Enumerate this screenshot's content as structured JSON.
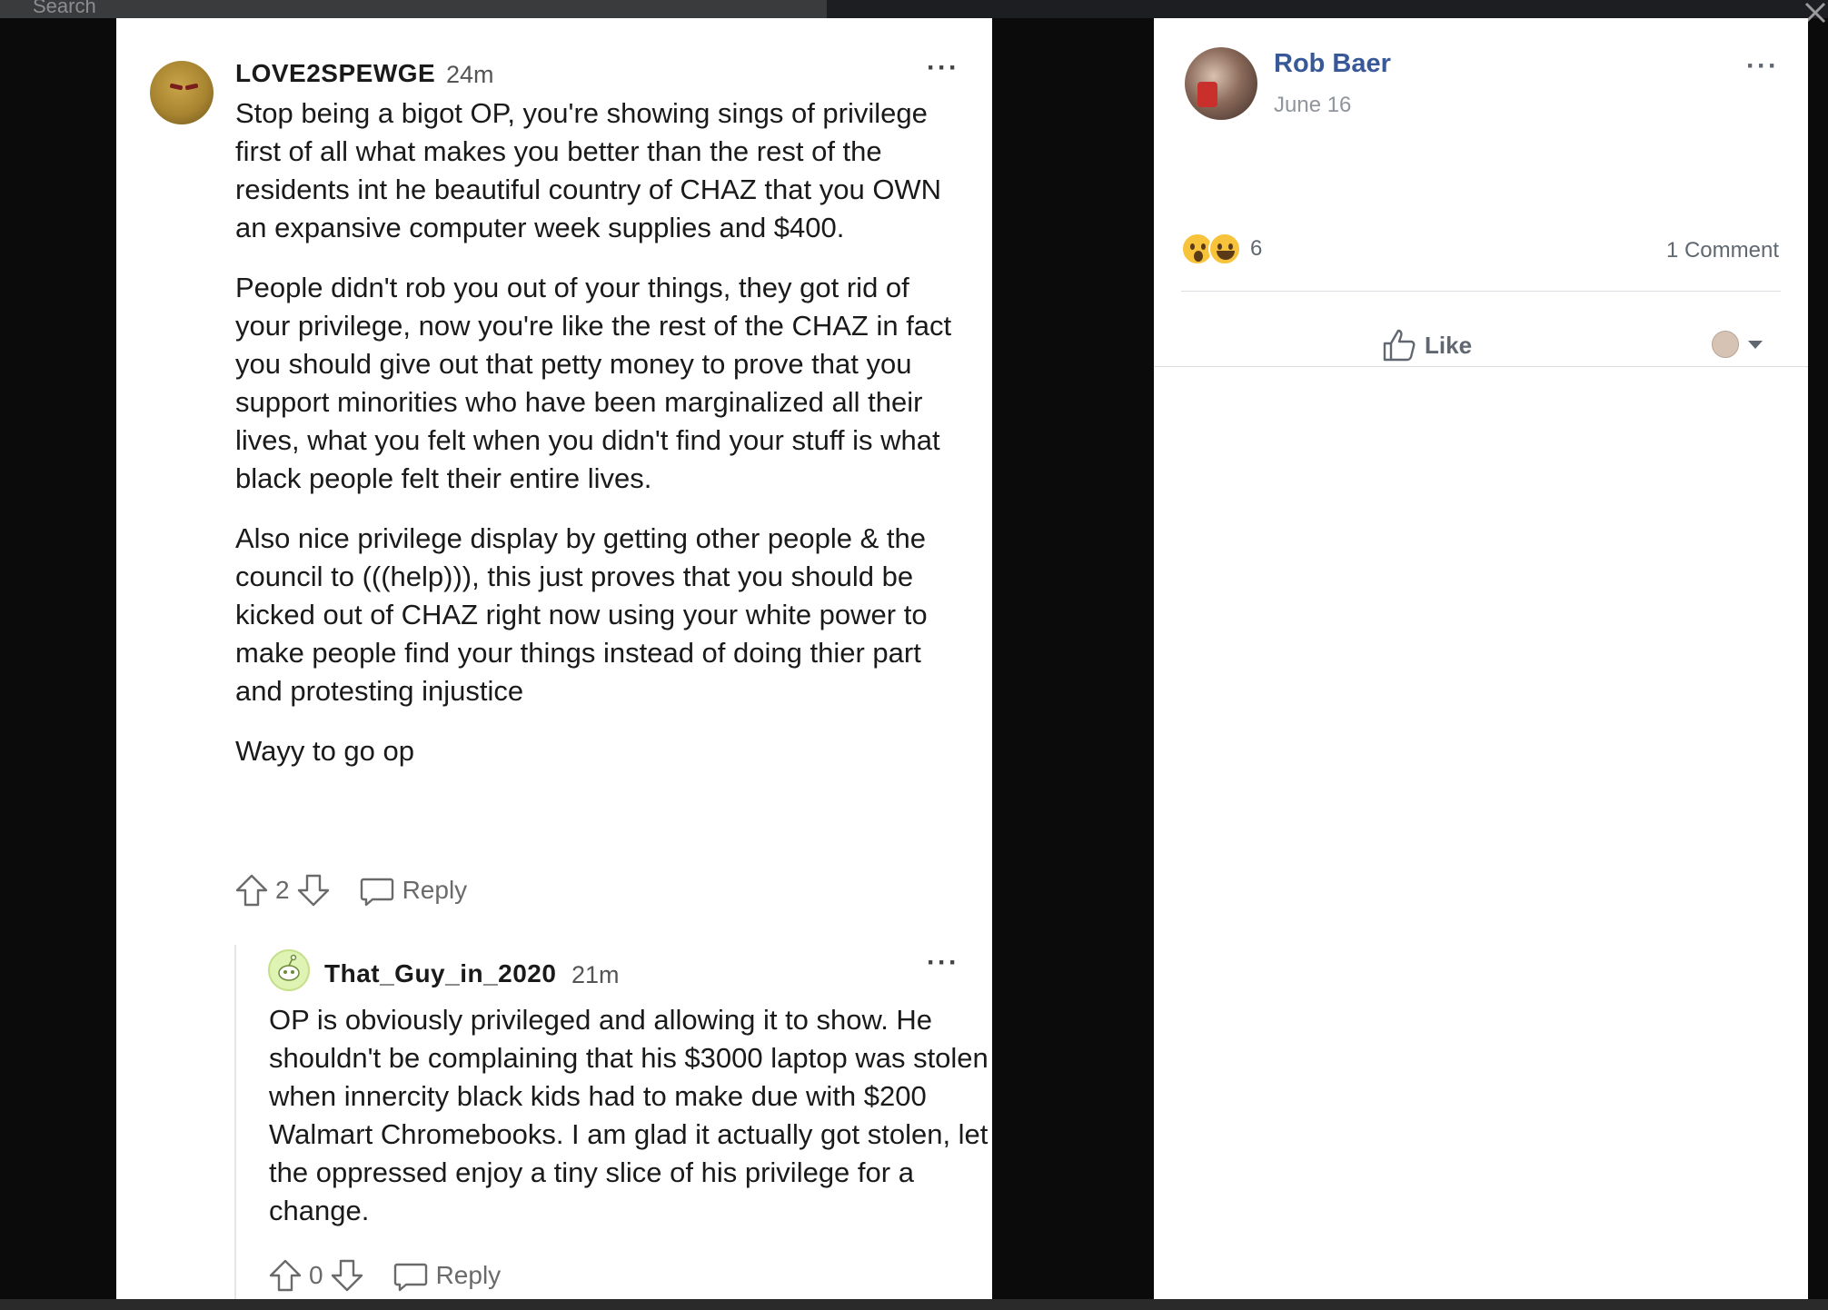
{
  "topbar": {
    "search_placeholder": "Search",
    "close_icon": "close-icon"
  },
  "reddit": {
    "comment1": {
      "username": "LOVE2SPEWGE",
      "time": "24m",
      "more": "···",
      "paragraphs": [
        "Stop being a bigot OP, you're showing sings of privilege first of all what makes you better than the rest of the residents int he beautiful country of CHAZ that you OWN an expansive computer week supplies and $400.",
        "People didn't rob you out of your things, they got rid of your privilege, now you're like the rest of the CHAZ in fact you should give out that petty money to prove that you support minorities who have been marginalized all their lives, what you felt when you didn't find your stuff is what black people felt their entire lives.",
        "Also nice privilege display by getting other people & the council to (((help))), this just proves that you should be kicked out of CHAZ right now using your white power to make people find your things instead of doing thier part and protesting injustice",
        "Wayy to go op"
      ],
      "votes": "2",
      "reply_label": "Reply"
    },
    "comment2": {
      "username": "That_Guy_in_2020",
      "time": "21m",
      "more": "···",
      "paragraphs": [
        "OP is obviously privileged and allowing it to show. He shouldn't be complaining that his $3000 laptop was stolen when innercity black kids had to make due with $200 Walmart Chromebooks. I am glad it actually got stolen, let the oppressed enjoy a tiny slice of his privilege for a change."
      ],
      "votes": "0",
      "reply_label": "Reply"
    }
  },
  "facebook": {
    "author": "Rob Baer",
    "date": "June 16",
    "more": "···",
    "reaction_count": "6",
    "comments_label": "1 Comment",
    "like_label": "Like",
    "colors": {
      "name": "#385898",
      "meta": "#90949c"
    }
  }
}
